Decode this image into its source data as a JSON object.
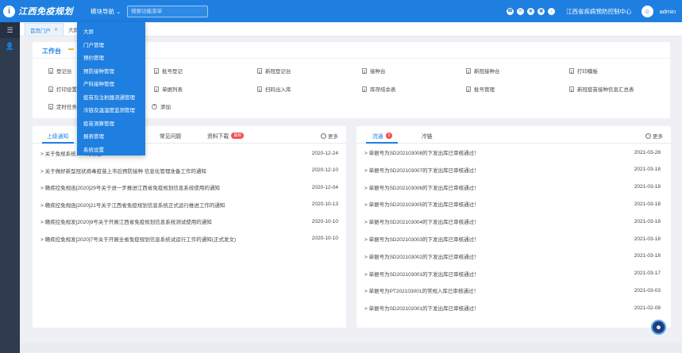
{
  "app": {
    "title": "江西免疫规划",
    "nav_label": "模块导航",
    "search_placeholder": "搜索功能菜单",
    "org_name": "江西省疾病预防控制中心",
    "username": "admin"
  },
  "tabs": [
    {
      "label": "首页门户",
      "closable": true,
      "active": true
    },
    {
      "label": "大屏",
      "closable": false,
      "active": false
    }
  ],
  "workbench": {
    "title": "工作台",
    "items": [
      {
        "label": "登记台"
      },
      {
        "label": "批号登记"
      },
      {
        "label": "新冠登记台"
      },
      {
        "label": "接种台"
      },
      {
        "label": "新冠接种台"
      },
      {
        "label": "打印模板"
      },
      {
        "label": "打印设置"
      },
      {
        "label": "单据列表"
      },
      {
        "label": "扫码出入库"
      },
      {
        "label": "库存结余表"
      },
      {
        "label": "批号管理"
      },
      {
        "label": "新冠疫苗接种信息汇总表"
      },
      {
        "label": "定时任务"
      },
      {
        "label": "添加"
      }
    ]
  },
  "dropdown": {
    "items": [
      "大屏",
      "门户管理",
      "预约管理",
      "预防接种管理",
      "产科接种管理",
      "疫苗及注射器流通管理",
      "冷链及温湿度监测管理",
      "疫苗测算管理",
      "报表管理",
      "系统设置"
    ]
  },
  "notice": {
    "tabs": [
      {
        "label": "上级通知",
        "active": true
      },
      {
        "label": "常见问题",
        "active": false
      },
      {
        "label": "资料下载",
        "badge": "最新",
        "active": false
      }
    ],
    "more_label": "更多",
    "rows": [
      {
        "title": "> 关于免规系统……的公告",
        "date": "2020-12-24"
      },
      {
        "title": "> 关于做好新型冠状病毒疫苗上市后预防接种 信息化管理准备工作的通知",
        "date": "2020-12-10"
      },
      {
        "title": "> 赣疾控免规函[2020]29号关于进一步推进江西省免疫规划信息系统使用的通知",
        "date": "2020-12-04"
      },
      {
        "title": "> 赣疾控免规函[2020]21号关于江西省免疫规划信息系统正式运行推进工作的通知",
        "date": "2020-10-13"
      },
      {
        "title": "> 赣疾控免规发[2020]9号关于开展江西省免疫规划信息系统测试使用的通知",
        "date": "2020-10-10"
      },
      {
        "title": "> 赣疾控免规发[2020]7号关于开展全省免疫规划信息系统试运行工作的通知(正式发文)",
        "date": "2020-10-10"
      }
    ]
  },
  "flow": {
    "tabs": [
      {
        "label": "流通",
        "badge": "0",
        "active": true
      },
      {
        "label": "冷链",
        "active": false
      }
    ],
    "more_label": "更多",
    "rows": [
      {
        "title": "> 单据号为SD202103008的下发出库已审核通过！",
        "date": "2021-03-28"
      },
      {
        "title": "> 单据号为SD202103007的下发出库已审核通过！",
        "date": "2021-03-18"
      },
      {
        "title": "> 单据号为SD202103006的下发出库已审核通过！",
        "date": "2021-03-18"
      },
      {
        "title": "> 单据号为SD202103005的下发出库已审核通过！",
        "date": "2021-03-18"
      },
      {
        "title": "> 单据号为SD202103004的下发出库已审核通过！",
        "date": "2021-03-18"
      },
      {
        "title": "> 单据号为SD202103003的下发出库已审核通过！",
        "date": "2021-03-18"
      },
      {
        "title": "> 单据号为SD202103002的下发出库已审核通过！",
        "date": "2021-03-18"
      },
      {
        "title": "> 单据号为SD202103001的下发出库已审核通过！",
        "date": "2021-03-17"
      },
      {
        "title": "> 单据号为PT202103001的常规入库已审核通过！",
        "date": "2021-03-03"
      },
      {
        "title": "> 单据号为SD202102001的下发出库已审核通过！",
        "date": "2021-02-08"
      }
    ]
  },
  "colors": {
    "primary": "#1e7fe0",
    "rail": "#2f3b4e",
    "badge": "#f04d4d"
  }
}
